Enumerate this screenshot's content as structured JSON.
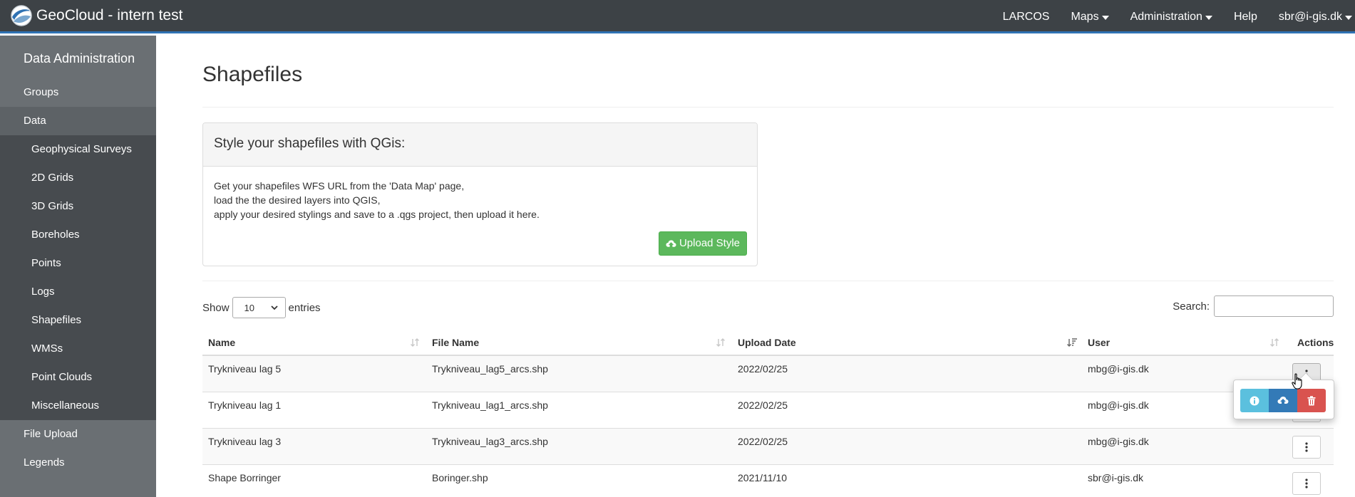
{
  "navbar": {
    "brand": "GeoCloud - intern test",
    "items": [
      {
        "label": "LARCOS",
        "dropdown": false
      },
      {
        "label": "Maps",
        "dropdown": true
      },
      {
        "label": "Administration",
        "dropdown": true
      },
      {
        "label": "Help",
        "dropdown": false
      },
      {
        "label": "sbr@i-gis.dk",
        "dropdown": true
      }
    ]
  },
  "sidebar": {
    "title": "Data Administration",
    "top_items": [
      "Groups",
      "Data"
    ],
    "sub_items": [
      "Geophysical Surveys",
      "2D Grids",
      "3D Grids",
      "Boreholes",
      "Points",
      "Logs",
      "Shapefiles",
      "WMSs",
      "Point Clouds",
      "Miscellaneous"
    ],
    "bottom_items": [
      "File Upload",
      "Legends"
    ]
  },
  "main": {
    "title": "Shapefiles",
    "panel": {
      "heading": "Style your shapefiles with QGis:",
      "lines": [
        "Get your shapefiles WFS URL from the 'Data Map' page,",
        "load the the desired layers into QGIS,",
        "apply your desired stylings and save to a .qgs project, then upload it here."
      ],
      "button_label": "Upload Style"
    },
    "length": {
      "prefix": "Show",
      "value": "10",
      "suffix": "entries"
    },
    "search_label": "Search:",
    "search_value": ""
  },
  "table": {
    "headers": [
      "Name",
      "File Name",
      "Upload Date",
      "User",
      "Actions"
    ],
    "rows": [
      {
        "name": "Trykniveau lag 5",
        "file": "Trykniveau_lag5_arcs.shp",
        "date": "2022/02/25",
        "user": "mbg@i-gis.dk"
      },
      {
        "name": "Trykniveau lag 1",
        "file": "Trykniveau_lag1_arcs.shp",
        "date": "2022/02/25",
        "user": "mbg@i-gis.dk"
      },
      {
        "name": "Trykniveau lag 3",
        "file": "Trykniveau_lag3_arcs.shp",
        "date": "2022/02/25",
        "user": "mbg@i-gis.dk"
      },
      {
        "name": "Shape Borringer",
        "file": "Boringer.shp",
        "date": "2021/11/10",
        "user": "sbr@i-gis.dk"
      }
    ]
  },
  "icons": {
    "brand": "globe-logo",
    "upload": "cloud-upload-icon",
    "actions": "vertical-ellipsis-icon",
    "info": "info-icon",
    "delete": "trash-icon",
    "sort": "sort-icon"
  },
  "colors": {
    "navbar": "#3d4246",
    "navbar_accent": "#2f72b3",
    "sidebar": "#6a6f73",
    "sidebar_sub": "#474b4f",
    "success": "#5cb85c",
    "info": "#5bc0de",
    "primary": "#337ab7",
    "danger": "#d9534f"
  }
}
